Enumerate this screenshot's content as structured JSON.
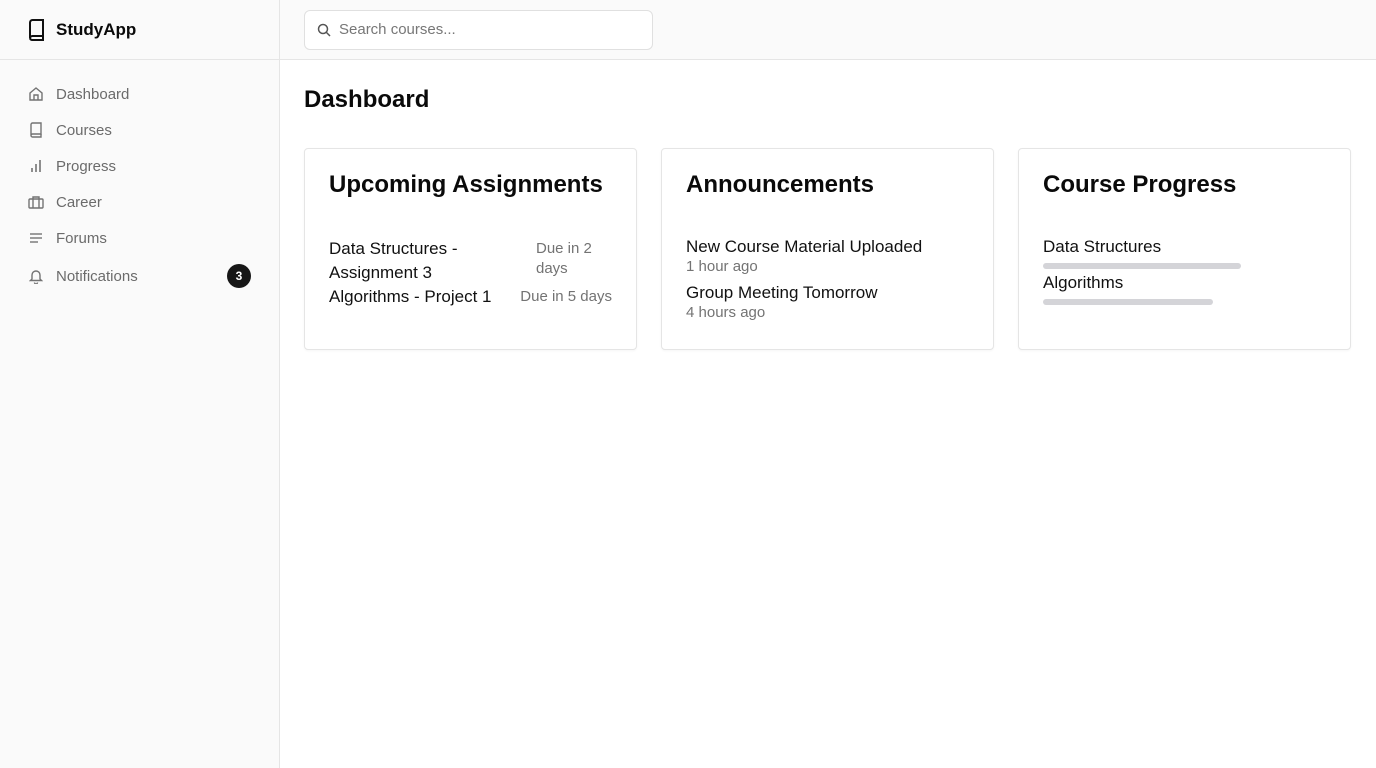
{
  "app": {
    "title": "StudyApp"
  },
  "sidebar": {
    "items": [
      {
        "label": "Dashboard",
        "icon": "home-icon"
      },
      {
        "label": "Courses",
        "icon": "book-icon"
      },
      {
        "label": "Progress",
        "icon": "bar-chart-icon"
      },
      {
        "label": "Career",
        "icon": "briefcase-icon"
      },
      {
        "label": "Forums",
        "icon": "lines-icon"
      },
      {
        "label": "Notifications",
        "icon": "bell-icon",
        "badge": "3"
      }
    ]
  },
  "search": {
    "placeholder": "Search courses..."
  },
  "page": {
    "title": "Dashboard"
  },
  "cards": {
    "assignments": {
      "title": "Upcoming Assignments",
      "items": [
        {
          "name": "Data Structures - Assignment 3",
          "due": "Due in 2 days"
        },
        {
          "name": "Algorithms - Project 1",
          "due": "Due in 5 days"
        }
      ]
    },
    "announcements": {
      "title": "Announcements",
      "items": [
        {
          "title": "New Course Material Uploaded",
          "time": "1 hour ago"
        },
        {
          "title": "Group Meeting Tomorrow",
          "time": "4 hours ago"
        }
      ]
    },
    "progress": {
      "title": "Course Progress",
      "items": [
        {
          "name": "Data Structures",
          "fraction": 0.7
        },
        {
          "name": "Algorithms",
          "fraction": 0.6
        }
      ]
    }
  }
}
